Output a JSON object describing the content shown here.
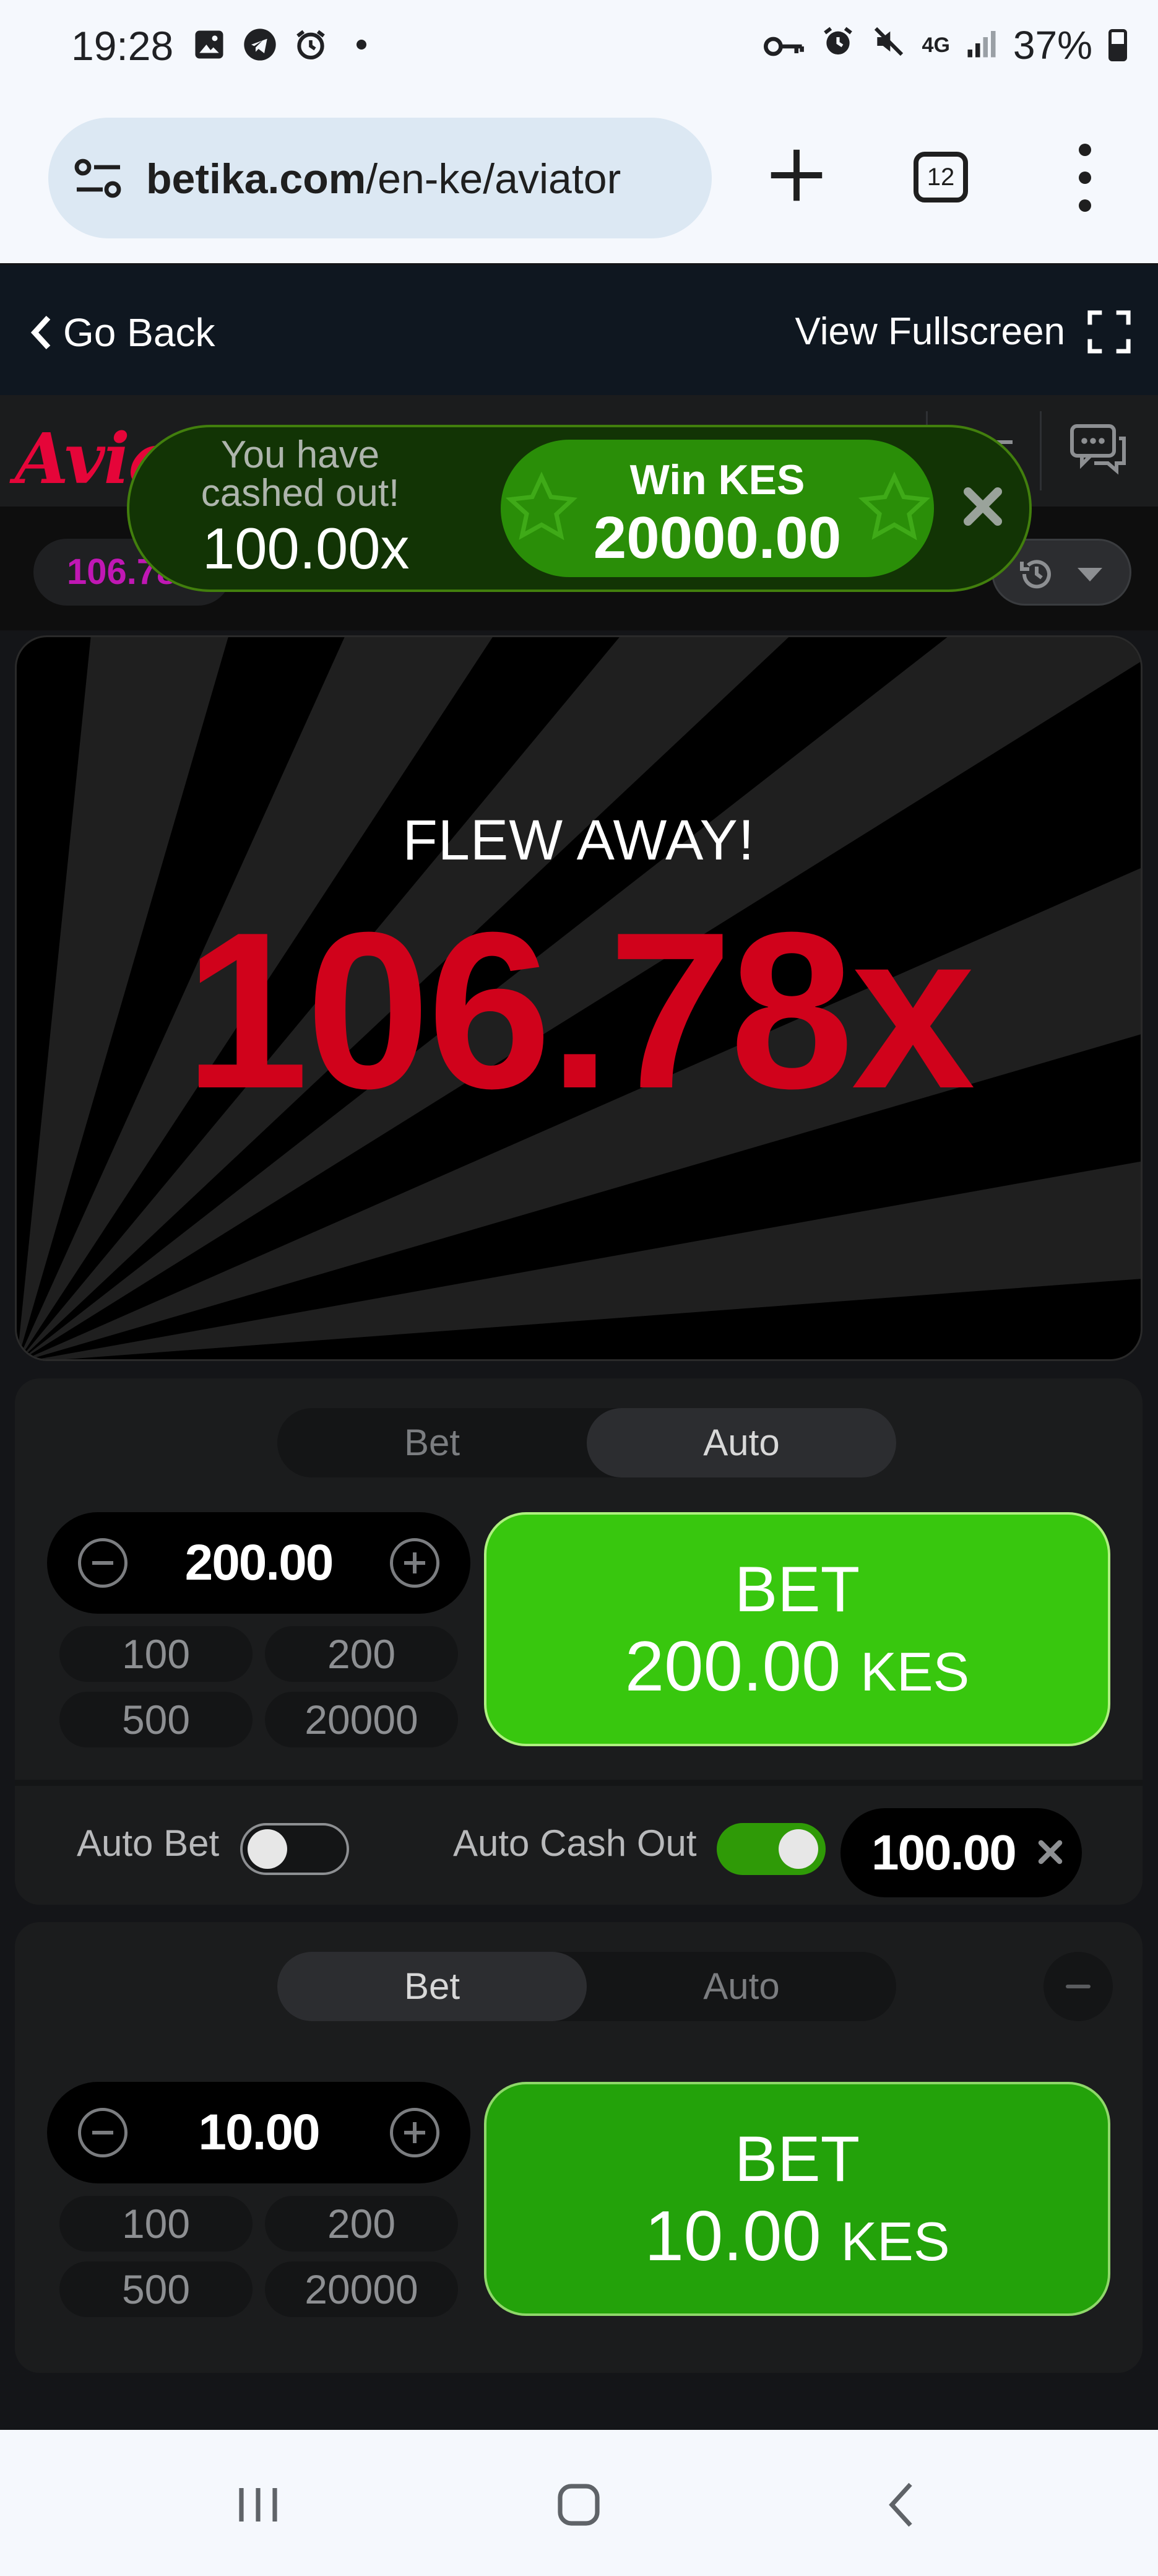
{
  "status_bar": {
    "time": "19:28",
    "battery": "37%",
    "network": "4G"
  },
  "browser": {
    "url_domain": "betika.com",
    "url_path": "/en-ke/aviator",
    "tab_count": "12"
  },
  "top_bar": {
    "go_back": "Go Back",
    "fullscreen": "View Fullscreen"
  },
  "game_header": {
    "logo": "Aviator"
  },
  "history": {
    "first_value": "106.78x"
  },
  "toast": {
    "message": "You have cashed out!",
    "multiplier": "100.00x",
    "win_label": "Win KES",
    "win_amount": "20000.00"
  },
  "stage": {
    "status": "FLEW AWAY!",
    "multiplier": "106.78x",
    "accent_color": "#d0021b"
  },
  "panel1": {
    "tabs": [
      "Bet",
      "Auto"
    ],
    "active_tab": "Auto",
    "stake": "200.00",
    "quick_amounts": [
      "100",
      "200",
      "500",
      "20000"
    ],
    "bet_label": "BET",
    "bet_amount": "200.00",
    "currency": "KES",
    "auto_bet_label": "Auto Bet",
    "auto_bet_on": false,
    "auto_cashout_label": "Auto Cash Out",
    "auto_cashout_on": true,
    "auto_cashout_value": "100.00"
  },
  "panel2": {
    "tabs": [
      "Bet",
      "Auto"
    ],
    "active_tab": "Bet",
    "stake": "10.00",
    "quick_amounts": [
      "100",
      "200",
      "500",
      "20000"
    ],
    "bet_label": "BET",
    "bet_amount": "10.00",
    "currency": "KES"
  },
  "colors": {
    "bet_green": "#38c70e",
    "toast_green": "#2a8e08",
    "brand_red": "#e50539"
  }
}
